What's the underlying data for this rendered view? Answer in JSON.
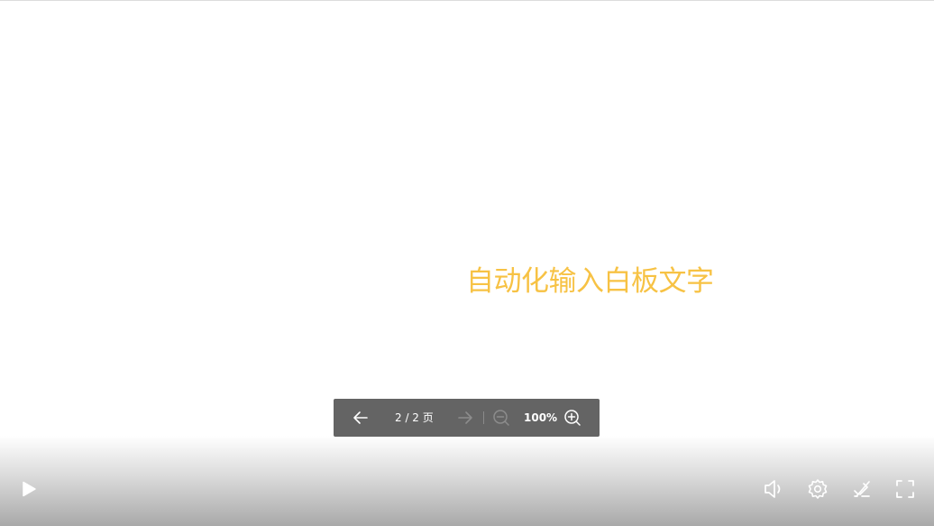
{
  "whiteboard": {
    "text": "自动化输入白板文字",
    "text_color": "#f7c244"
  },
  "page_toolbar": {
    "prev_page_icon": "arrow-left-icon",
    "page_indicator": "2 / 2 页",
    "next_page_icon": "arrow-right-icon",
    "next_page_enabled": false,
    "zoom_out_icon": "zoom-out-icon",
    "zoom_out_enabled": false,
    "zoom_level": "100%",
    "zoom_in_icon": "zoom-in-icon"
  },
  "control_bar": {
    "play_icon": "play-icon",
    "volume_icon": "volume-icon",
    "settings_icon": "gear-icon",
    "annotation_toggle_icon": "pen-off-icon",
    "fullscreen_icon": "fullscreen-icon"
  },
  "colors": {
    "toolbar_bg": "#646464",
    "icon_active": "#ffffff",
    "icon_disabled": "#8c8c8c",
    "accent_text": "#f7c244"
  }
}
